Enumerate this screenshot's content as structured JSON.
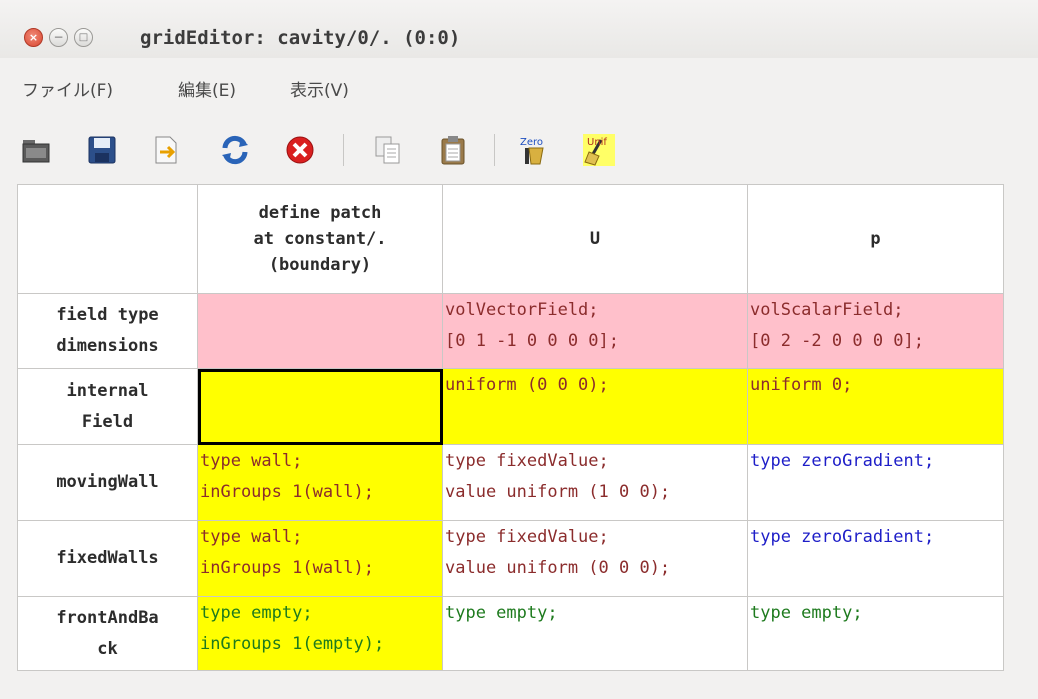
{
  "window": {
    "title": "gridEditor: cavity/0/. (0:0)",
    "buttons": {
      "close": "×",
      "minimize": "−",
      "maximize": "□"
    }
  },
  "menubar": {
    "items": [
      {
        "label": "ファイル(F)"
      },
      {
        "label": "編集(E)"
      },
      {
        "label": "表示(V)"
      }
    ]
  },
  "toolbar": {
    "buttons": [
      {
        "icon": "open-folder-icon"
      },
      {
        "icon": "save-icon"
      },
      {
        "icon": "export-icon"
      },
      {
        "icon": "reload-icon"
      },
      {
        "icon": "cancel-icon"
      },
      {
        "icon": "copy-icon"
      },
      {
        "icon": "paste-icon"
      },
      {
        "icon": "zero-icon",
        "text": "Zero"
      },
      {
        "icon": "uniform-icon",
        "text": "Unif"
      }
    ]
  },
  "grid": {
    "corner": "",
    "columns": [
      {
        "label": "define patch\nat constant/.\n(boundary)"
      },
      {
        "label": "U"
      },
      {
        "label": "p"
      }
    ],
    "rows": [
      {
        "header": "field type\ndimensions",
        "cells": [
          {
            "text": "",
            "bg": "#ffc0cb",
            "color": ""
          },
          {
            "text": "volVectorField;\n[0 1 -1 0 0 0 0];",
            "bg": "#ffc0cb",
            "color": "#8b2c2c"
          },
          {
            "text": "volScalarField;\n[0 2 -2 0 0 0 0];",
            "bg": "#ffc0cb",
            "color": "#8b2c2c"
          }
        ]
      },
      {
        "header": "internal\nField",
        "cells": [
          {
            "text": "",
            "bg": "#ffff00",
            "color": "",
            "selected": true
          },
          {
            "text": "uniform (0 0 0);",
            "bg": "#ffff00",
            "color": "#8b2c2c"
          },
          {
            "text": "uniform 0;",
            "bg": "#ffff00",
            "color": "#8b2c2c"
          }
        ]
      },
      {
        "header": "movingWall",
        "cells": [
          {
            "text": "type wall;\ninGroups 1(wall);",
            "bg": "#ffff00",
            "color": "#8b2c2c"
          },
          {
            "text": "type fixedValue;\nvalue uniform (1 0 0);",
            "bg": "#ffffff",
            "color": "#8b2c2c"
          },
          {
            "text": "type zeroGradient;",
            "bg": "#ffffff",
            "color": "#1e1ec8"
          }
        ]
      },
      {
        "header": "fixedWalls",
        "cells": [
          {
            "text": "type wall;\ninGroups 1(wall);",
            "bg": "#ffff00",
            "color": "#8b2c2c"
          },
          {
            "text": "type fixedValue;\nvalue uniform (0 0 0);",
            "bg": "#ffffff",
            "color": "#8b2c2c"
          },
          {
            "text": "type zeroGradient;",
            "bg": "#ffffff",
            "color": "#1e1ec8"
          }
        ]
      },
      {
        "header": "frontAndBa\nck",
        "cells": [
          {
            "text": "type empty;\ninGroups 1(empty);",
            "bg": "#ffff00",
            "color": "#1d7a1d"
          },
          {
            "text": "type empty;",
            "bg": "#ffffff",
            "color": "#1d7a1d"
          },
          {
            "text": "type empty;",
            "bg": "#ffffff",
            "color": "#1d7a1d"
          }
        ]
      }
    ]
  }
}
